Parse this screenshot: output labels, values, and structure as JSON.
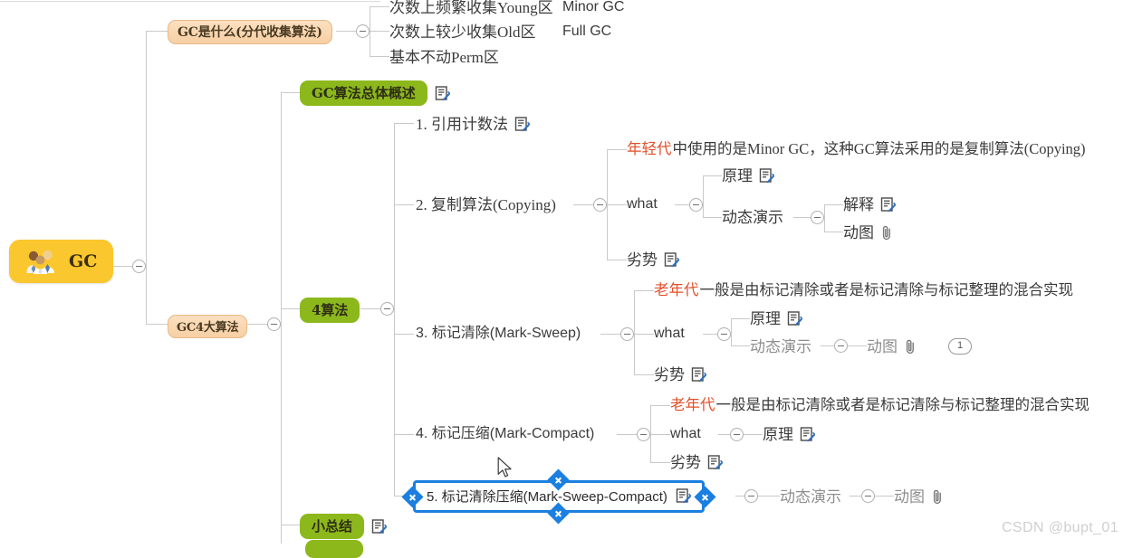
{
  "app": {
    "type": "mindmap",
    "watermark": "CSDN @bupt_01",
    "accent_selected": "#1a7fe0",
    "color_peach": "#f7cfa4",
    "color_green": "#8cb81c",
    "color_root": "#fbc72e",
    "color_line": "#c9c9c9",
    "color_red_text": "#e2502a",
    "color_grey_text": "#8e8e8e"
  },
  "root": {
    "label": "GC",
    "icon": "people-group-icon"
  },
  "branches": {
    "what_is_gc": {
      "label": "GC是什么(分代收集算法)",
      "children": [
        {
          "label": "次数上频繁收集Young区",
          "extra": "Minor GC"
        },
        {
          "label": "次数上较少收集Old区",
          "extra": "Full GC"
        },
        {
          "label": "基本不动Perm区",
          "extra": ""
        }
      ]
    },
    "gc_overview": {
      "label": "GC算法总体概述",
      "note_icon": "note-icon"
    },
    "gc4": {
      "label": "GC4大算法"
    },
    "four_algorithms": {
      "label": "4算法",
      "items": [
        {
          "label": "1. 引用计数法",
          "note_icon": "note-icon",
          "children": []
        },
        {
          "label": "2. 复制算法(Copying)",
          "children": [
            {
              "label_red": "年轻代",
              "label_rest": "中使用的是Minor GC，这种GC算法采用的是复制算法(Copying)"
            },
            {
              "label": "what",
              "children": [
                {
                  "label": "原理",
                  "note_icon": "note-icon"
                },
                {
                  "label": "动态演示",
                  "children": [
                    {
                      "label": "解释",
                      "note_icon": "note-icon"
                    },
                    {
                      "label": "动图",
                      "clip_icon": "paperclip-icon"
                    }
                  ]
                }
              ]
            },
            {
              "label": "劣势",
              "note_icon": "note-icon"
            }
          ]
        },
        {
          "label": "3. 标记清除(Mark-Sweep)",
          "children": [
            {
              "label_red": "老年代",
              "label_rest": "一般是由标记清除或者是标记清除与标记整理的混合实现"
            },
            {
              "label": "what",
              "children": [
                {
                  "label": "原理",
                  "note_icon": "note-icon"
                },
                {
                  "label": "动态演示",
                  "muted": true,
                  "children": [
                    {
                      "label": "动图",
                      "clip_icon": "paperclip-icon",
                      "badge": "1"
                    }
                  ]
                }
              ]
            },
            {
              "label": "劣势",
              "note_icon": "note-icon"
            }
          ]
        },
        {
          "label": "4. 标记压缩(Mark-Compact)",
          "children": [
            {
              "label_red": "老年代",
              "label_rest": "一般是由标记清除或者是标记清除与标记整理的混合实现"
            },
            {
              "label": "what",
              "children": [
                {
                  "label": "原理",
                  "note_icon": "note-icon"
                }
              ]
            },
            {
              "label": "劣势",
              "note_icon": "note-icon"
            }
          ]
        },
        {
          "label": "5. 标记清除压缩(Mark-Sweep-Compact)",
          "selected": true,
          "note_icon": "note-icon",
          "children": [
            {
              "label": "动态演示",
              "muted": true,
              "children": [
                {
                  "label": "动图",
                  "clip_icon": "paperclip-icon"
                }
              ]
            }
          ]
        }
      ]
    },
    "summary": {
      "label": "小总结",
      "note_icon": "note-icon"
    }
  }
}
